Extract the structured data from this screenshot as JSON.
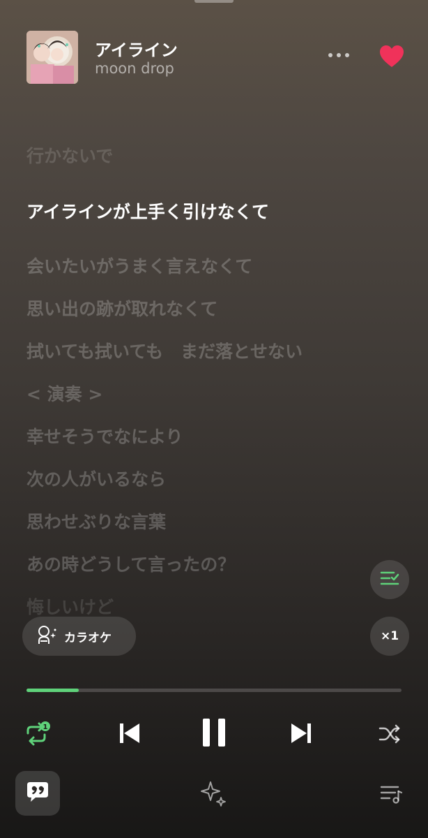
{
  "track": {
    "title": "アイライン",
    "artist": "moon drop",
    "liked": true
  },
  "lyrics": [
    {
      "text": "行かないで",
      "state": "dim"
    },
    {
      "text": "アイラインが上手く引けなくて",
      "state": "active"
    },
    {
      "text": "会いたいがうまく言えなくて",
      "state": "upcoming"
    },
    {
      "text": "思い出の跡が取れなくて",
      "state": "upcoming"
    },
    {
      "text": "拭いても拭いても　まだ落とせない",
      "state": "upcoming"
    },
    {
      "text": "< 演奏 >",
      "state": "upcoming"
    },
    {
      "text": "幸せそうでなにより",
      "state": "upcoming"
    },
    {
      "text": "次の人がいるなら",
      "state": "upcoming"
    },
    {
      "text": "思わせぶりな言葉",
      "state": "upcoming"
    },
    {
      "text": "あの時どうして言ったの？",
      "state": "upcoming"
    },
    {
      "text": "悔しいけど",
      "state": "fade"
    }
  ],
  "controls": {
    "karaoke_label": "カラオケ",
    "speed_label": "×1",
    "repeat_badge": "1",
    "progress": 0.14
  },
  "colors": {
    "accent": "#5fd27a",
    "heart": "#f0325a"
  },
  "icons": {
    "more": "more-icon",
    "heart": "heart-icon",
    "lyric_list": "lyric-list-icon",
    "karaoke": "microphone-icon",
    "repeat": "repeat-one-icon",
    "prev": "previous-icon",
    "pause": "pause-icon",
    "next": "next-icon",
    "shuffle": "shuffle-icon",
    "lyrics": "quote-icon",
    "sparkle": "sparkle-icon",
    "queue": "queue-icon"
  }
}
